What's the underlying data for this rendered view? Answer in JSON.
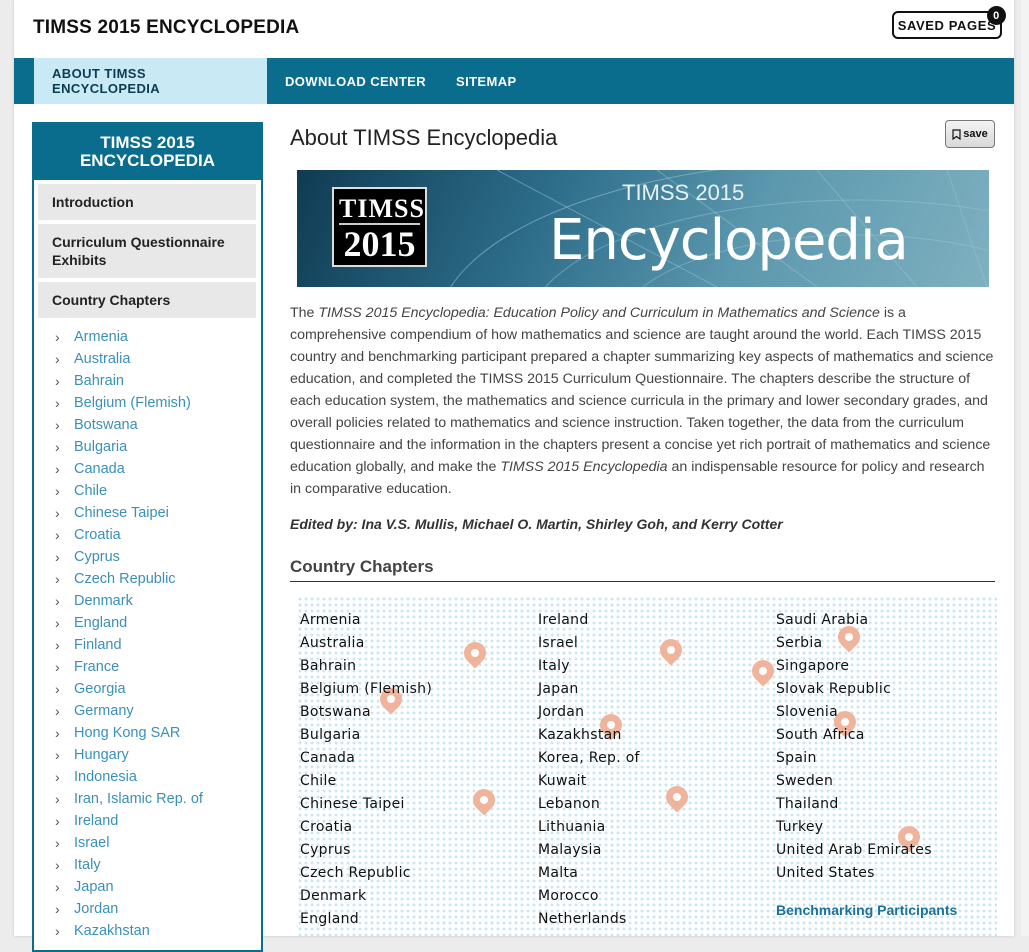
{
  "header": {
    "site_title": "TIMSS 2015 ENCYCLOPEDIA",
    "saved_pages_label": "SAVED PAGES",
    "saved_count": "0"
  },
  "nav": {
    "items": [
      {
        "label": "ABOUT TIMSS ENCYCLOPEDIA",
        "active": true
      },
      {
        "label": "DOWNLOAD CENTER",
        "active": false
      },
      {
        "label": "SITEMAP",
        "active": false
      }
    ]
  },
  "sidebar": {
    "title": "TIMSS 2015 ENCYCLOPEDIA",
    "blocks": [
      "Introduction",
      "Curriculum Questionnaire Exhibits",
      "Country Chapters"
    ],
    "countries": [
      "Armenia",
      "Australia",
      "Bahrain",
      "Belgium (Flemish)",
      "Botswana",
      "Bulgaria",
      "Canada",
      "Chile",
      "Chinese Taipei",
      "Croatia",
      "Cyprus",
      "Czech Republic",
      "Denmark",
      "England",
      "Finland",
      "France",
      "Georgia",
      "Germany",
      "Hong Kong SAR",
      "Hungary",
      "Indonesia",
      "Iran, Islamic Rep. of",
      "Ireland",
      "Israel",
      "Italy",
      "Japan",
      "Jordan",
      "Kazakhstan"
    ]
  },
  "main": {
    "title": "About TIMSS Encyclopedia",
    "save_label": "save",
    "banner": {
      "logo_line1": "TIMSS",
      "logo_line2": "2015",
      "subtitle": "TIMSS 2015",
      "main": "Encyclopedia"
    },
    "intro": {
      "p1": "The ",
      "em1": "TIMSS 2015 Encyclopedia: Education Policy and Curriculum in Mathematics and Science",
      "p2": " is a comprehensive compendium of how mathematics and science are taught around the world. Each TIMSS 2015 country and benchmarking participant prepared a chapter summarizing key aspects of mathematics and science education, and completed the TIMSS 2015 Curriculum Questionnaire. The chapters describe the structure of each education system, the mathematics and science curricula in the primary and lower secondary grades, and overall policies related to mathematics and science instruction. Taken together, the data from the curriculum questionnaire and the information in the chapters present a concise yet rich portrait of mathematics and science education globally, and make the ",
      "em2": "TIMSS 2015 Encyclopedia",
      "p3": " an indispensable resource for policy and research in comparative education."
    },
    "editors": "Edited by: Ina V.S. Mullis, Michael O. Martin, Shirley Goh, and Kerry Cotter",
    "section_title": "Country Chapters",
    "columns": [
      [
        "Armenia",
        "Australia",
        "Bahrain",
        "Belgium (Flemish)",
        "Botswana",
        "Bulgaria",
        "Canada",
        "Chile",
        "Chinese Taipei",
        "Croatia",
        "Cyprus",
        "Czech Republic",
        "Denmark",
        "England"
      ],
      [
        "Ireland",
        "Israel",
        "Italy",
        "Japan",
        "Jordan",
        "Kazakhstan",
        "Korea, Rep. of",
        "Kuwait",
        "Lebanon",
        "Lithuania",
        "Malaysia",
        "Malta",
        "Morocco",
        "Netherlands"
      ],
      [
        "Saudi Arabia",
        "Serbia",
        "Singapore",
        "Slovak Republic",
        "Slovenia",
        "South Africa",
        "Spain",
        "Sweden",
        "Thailand",
        "Turkey",
        "United Arab Emirates",
        "United States"
      ]
    ],
    "benchmarking_label": "Benchmarking Participants"
  },
  "colors": {
    "brand": "#0a6d8e",
    "active_nav_bg": "#c9eaf5",
    "link": "#3a90b8",
    "pin": "#efb49b"
  }
}
